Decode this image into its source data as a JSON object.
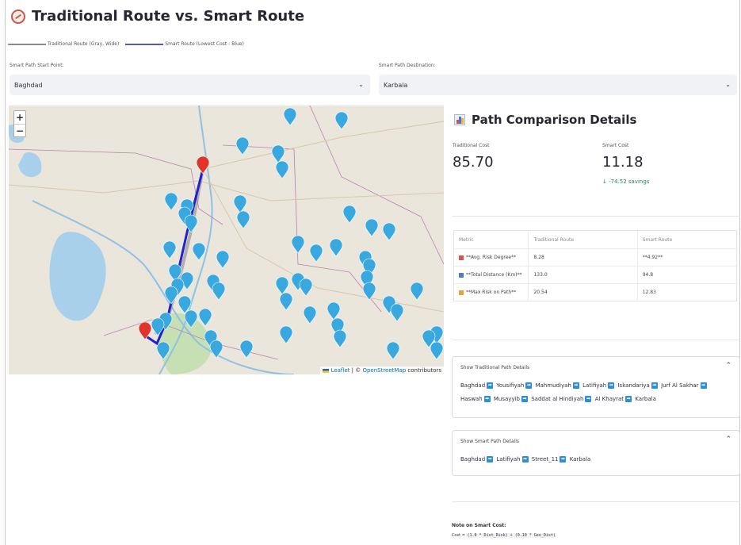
{
  "page": {
    "title": "Traditional Route vs. Smart Route"
  },
  "legend": {
    "traditional": {
      "label": "Traditional Route (Gray, Wide)",
      "color": "#8a8a8a"
    },
    "smart": {
      "label": "Smart Route (Lowest Cost - Blue)",
      "color": "#5a4fd6"
    }
  },
  "start": {
    "label": "Smart Path Start Point:",
    "value": "Baghdad"
  },
  "destination": {
    "label": "Smart Path Destination:",
    "value": "Karbala"
  },
  "map": {
    "zoom_in": "+",
    "zoom_out": "−",
    "attribution_leaflet": "Leaflet",
    "attribution_sep": " | © ",
    "attribution_osm": "OpenStreetMap",
    "attribution_tail": " contributors"
  },
  "panel": {
    "title": "Path Comparison Details"
  },
  "metrics": {
    "traditional_label": "Traditional Cost",
    "traditional_value": "85.70",
    "smart_label": "Smart Cost",
    "smart_value": "11.18",
    "smart_delta": "↓ -74.52 savings"
  },
  "table": {
    "headers": [
      "Metric",
      "Traditional Route",
      "Smart Route"
    ],
    "rows": [
      {
        "icon_color": "#d9534f",
        "metric": "**Avg. Risk Degree**",
        "traditional": "8.28",
        "smart": "**4.92**"
      },
      {
        "icon_color": "#4a7fc1",
        "metric": "**Total Distance (Km)**",
        "traditional": "133.0",
        "smart": "94.8"
      },
      {
        "icon_color": "#e8a33b",
        "metric": "**Max Risk on Path**",
        "traditional": "20.54",
        "smart": "12.83"
      }
    ]
  },
  "traditional_details": {
    "header": "Show Traditional Path Details",
    "steps": [
      "Baghdad",
      "Yousifiyah",
      "Mahmudiyah",
      "Latifiyah",
      "Iskandariya",
      "Jurf Al Sakhar",
      "Haswah",
      "Musayyib",
      "Saddat al Hindiyah",
      "Al Khayrat",
      "Karbala"
    ]
  },
  "smart_details": {
    "header": "Show Smart Path Details",
    "steps": [
      "Baghdad",
      "Latifiyah",
      "Street_11",
      "Karbala"
    ]
  },
  "note": {
    "title": "Note on Smart Cost:",
    "formula_prefix": "Cost = ",
    "formula_code": "(1.0 * Dist_Risk) + (0.10 * Geo_Dist)"
  }
}
